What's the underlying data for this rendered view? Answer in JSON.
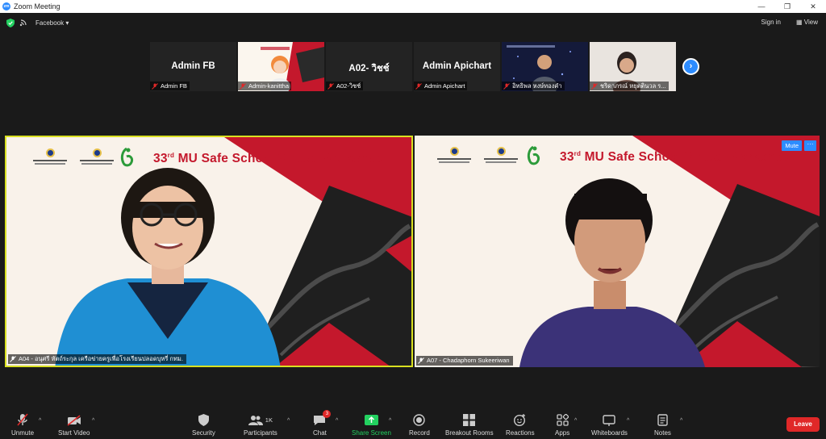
{
  "window": {
    "title": "Zoom Meeting",
    "controls": [
      "—",
      "❐",
      "✕"
    ],
    "app_icon_text": "zm"
  },
  "topbar": {
    "meeting_source": "Facebook ▾",
    "sign_in": "Sign in",
    "view": "View"
  },
  "thumbnails": [
    {
      "display_name": "Admin FB",
      "label": "Admin FB",
      "type": "name"
    },
    {
      "display_name": "",
      "label": "Admin-kanittha",
      "type": "video"
    },
    {
      "display_name": "A02- วิชช์",
      "label": "A02-วิชช์",
      "type": "name"
    },
    {
      "display_name": "Admin Apichart",
      "label": "Admin Apichart",
      "type": "name"
    },
    {
      "display_name": "",
      "label": "อิทธิพล หงษ์ทองคำ",
      "type": "video"
    },
    {
      "display_name": "",
      "label": "ชริดาภรณ์ หยุตตินวล ร...",
      "type": "video"
    }
  ],
  "next_page": "›",
  "tiles": [
    {
      "workshop_num": "33",
      "workshop_sup": "rd",
      "workshop_title": " MU Safe School Virtual Workshop",
      "label": "A04 - อนุศรี หัตถ์ระกุล เครือข่ายครูเพื่อโรงเรียนปลอดบุหรี่ กทม.",
      "active_speaker": true
    },
    {
      "workshop_num": "33",
      "workshop_sup": "rd",
      "workshop_title": " MU Safe School Virtual Workshop",
      "label": "A07 - Chadaphorn Sukeeriwan",
      "mute_label": "Mute",
      "more_label": "···",
      "active_speaker": false
    }
  ],
  "toolbar": {
    "unmute": "Unmute",
    "start_video": "Start Video",
    "security": "Security",
    "participants": "Participants",
    "participants_count": "1K",
    "chat": "Chat",
    "chat_badge": "3",
    "share_screen": "Share Screen",
    "record": "Record",
    "breakout_rooms": "Breakout Rooms",
    "reactions": "Reactions",
    "apps": "Apps",
    "whiteboards": "Whiteboards",
    "notes": "Notes",
    "leave": "Leave"
  },
  "colors": {
    "accent": "#2d8cff",
    "leave": "#e02828",
    "active_border": "#d9e021",
    "brand_red": "#c4182c",
    "share_green": "#23d160"
  }
}
